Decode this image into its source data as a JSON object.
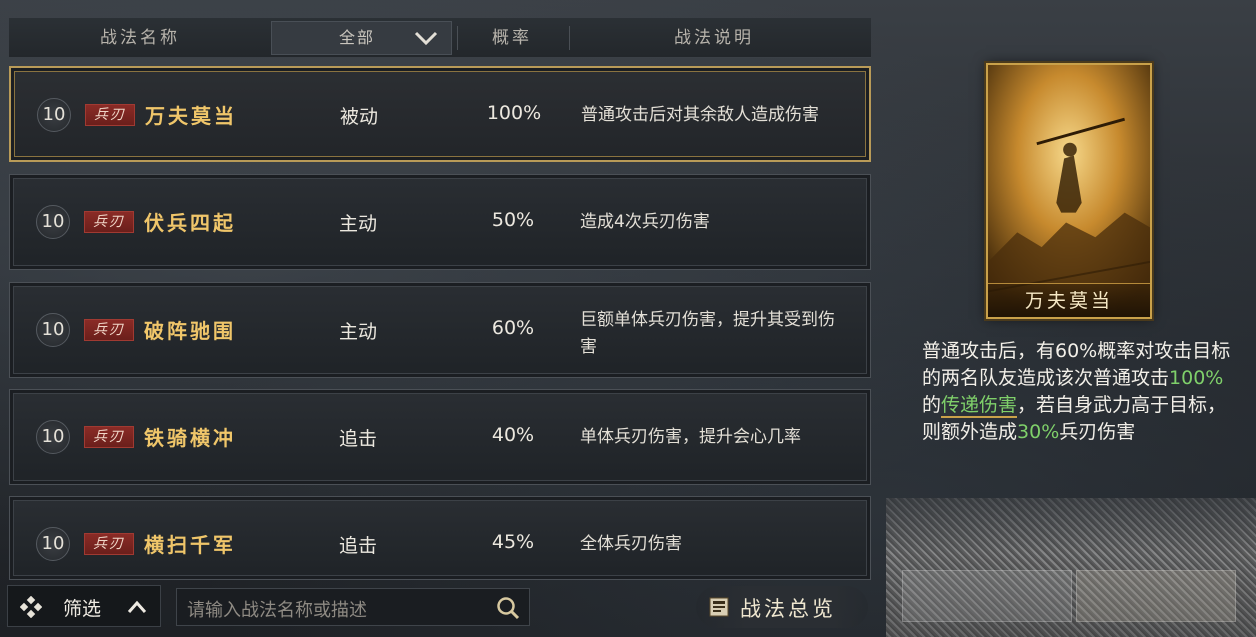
{
  "header": {
    "col_name": "战法名称",
    "filter_selected": "全部",
    "col_rate": "概率",
    "col_desc": "战法说明"
  },
  "rows": [
    {
      "level": "10",
      "tag": "兵刃",
      "name": "万夫莫当",
      "type": "被动",
      "rate": "100%",
      "desc": "普通攻击后对其余敌人造成伤害",
      "selected": true
    },
    {
      "level": "10",
      "tag": "兵刃",
      "name": "伏兵四起",
      "type": "主动",
      "rate": "50%",
      "desc": "造成4次兵刃伤害",
      "selected": false
    },
    {
      "level": "10",
      "tag": "兵刃",
      "name": "破阵驰围",
      "type": "主动",
      "rate": "60%",
      "desc": "巨额单体兵刃伤害，提升其受到伤害",
      "selected": false
    },
    {
      "level": "10",
      "tag": "兵刃",
      "name": "铁骑横冲",
      "type": "追击",
      "rate": "40%",
      "desc": "单体兵刃伤害，提升会心几率",
      "selected": false
    },
    {
      "level": "10",
      "tag": "兵刃",
      "name": "横扫千军",
      "type": "追击",
      "rate": "45%",
      "desc": "全体兵刃伤害",
      "selected": false
    }
  ],
  "bottom": {
    "filter_label": "筛选",
    "search_placeholder": "请输入战法名称或描述",
    "overview_label": "战法总览"
  },
  "detail": {
    "card_name": "万夫莫当",
    "desc_1": "普通攻击后，有60%概率对攻击目标的两名队友造成该次普通攻击",
    "desc_g1": "100%",
    "desc_2": "的",
    "desc_link": "传递伤害",
    "desc_3": "，若自身武力高于目标，则额外造成",
    "desc_g2": "30%",
    "desc_4": "兵刃伤害"
  },
  "colors": {
    "selected_border": "#b99b58",
    "name_gold": "#f0c66a",
    "tag_red": "#8a2b26",
    "highlight_green": "#7fd06a"
  }
}
